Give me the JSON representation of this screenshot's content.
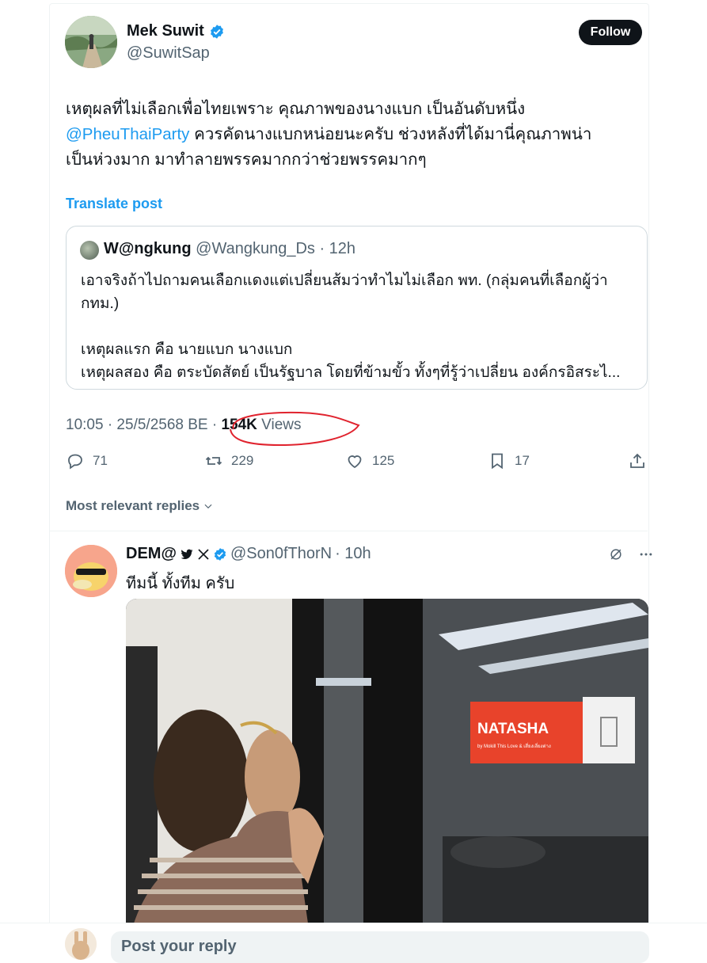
{
  "author": {
    "name": "Mek Suwit",
    "handle": "@SuwitSap",
    "follow_label": "Follow"
  },
  "tweet": {
    "line1": "เหตุผลที่ไม่เลือกเพื่อไทยเพราะ คุณภาพของนางแบก เป็นอันดับหนึ่ง",
    "mention": "@PheuThaiParty",
    "line2_rest": " ควรคัดนางแบกหน่อยนะครับ ช่วงหลังที่ได้มานี่คุณภาพน่า",
    "line3": "เป็นห่วงมาก มาทำลายพรรคมากกว่าช่วยพรรคมากๆ",
    "translate_label": "Translate post"
  },
  "quote": {
    "name": "W@ngkung",
    "handle": "@Wangkung_Ds",
    "time": "· 12h",
    "lines": [
      "เอาจริงถ้าไปถามคนเลือกแดงแต่เปลี่ยนส้มว่าทำไมไม่เลือก พท.  (กลุ่มคนที่เลือกผู้ว่า",
      "กทม.)",
      "",
      "เหตุผลแรก คือ  นายแบก นางแบก",
      "เหตุผลสอง คือ ตระบัดสัตย์ เป็นรัฐบาล โดยที่ข้ามขั้ว ทั้งๆที่รู้ว่าเปลี่ยน องค์กรอิสระไ..."
    ]
  },
  "meta": {
    "timestamp": "10:05 · 25/5/2568 BE ·",
    "views_count": "154K",
    "views_label": "Views"
  },
  "actions": {
    "replies": "71",
    "reposts": "229",
    "likes": "125",
    "bookmarks": "17"
  },
  "replies_sort_label": "Most relevant replies",
  "reply": {
    "name": "DEM@",
    "handle": "@Son0fThorN",
    "time": "· 10h",
    "text": "ทีมนี้ ทั้งทีม ครับ",
    "image_sign_text": "NATASHA",
    "image_sign_subtext": "by Mokill This Love & เสี่ยงเลี่ยงต่าง"
  },
  "composer": {
    "placeholder": "Post your reply"
  },
  "colors": {
    "accent": "#1d9bf0",
    "text": "#0f1419",
    "muted": "#536471",
    "annotation": "#e0232e"
  }
}
